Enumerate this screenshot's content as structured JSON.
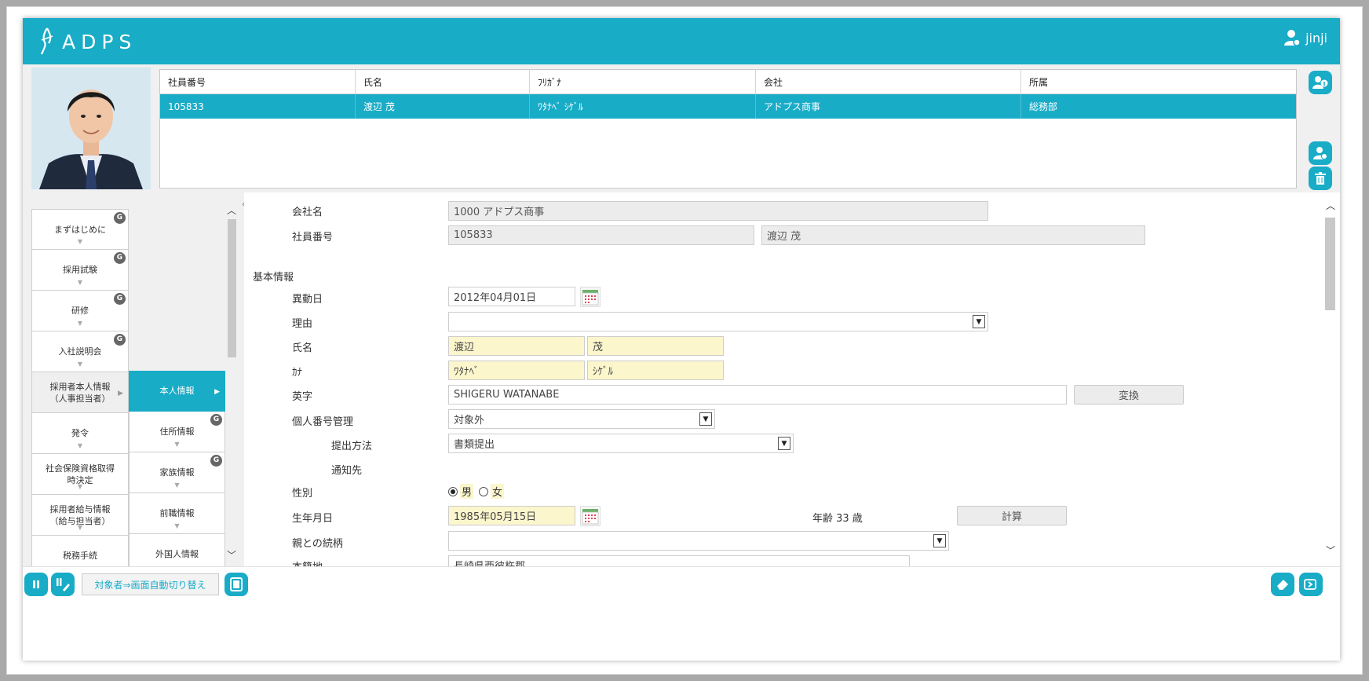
{
  "app": {
    "logo_text": "ADPS",
    "user_name": "jinji"
  },
  "employee_grid": {
    "headers": [
      "社員番号",
      "氏名",
      "ﾌﾘｶﾞﾅ",
      "会社",
      "所属"
    ],
    "row": [
      "105833",
      "渡辺 茂",
      "ﾜﾀﾅﾍﾞ ｼｹﾞﾙ",
      "アドプス商事",
      "総務部"
    ]
  },
  "nav": {
    "col1": [
      {
        "label": "まずはじめに",
        "badge": "G"
      },
      {
        "label": "採用試験",
        "badge": "G"
      },
      {
        "label": "研修",
        "badge": "G"
      },
      {
        "label": "入社説明会",
        "badge": "G"
      },
      {
        "label": "採用者本人情報\n（人事担当者）",
        "badge": ""
      },
      {
        "label": "発令",
        "badge": ""
      },
      {
        "label": "社会保険資格取得\n時決定",
        "badge": ""
      },
      {
        "label": "採用者給与情報\n（給与担当者）",
        "badge": ""
      },
      {
        "label": "税務手続",
        "badge": ""
      }
    ],
    "col2": [
      {
        "label": "本人情報",
        "badge": ""
      },
      {
        "label": "住所情報",
        "badge": "G"
      },
      {
        "label": "家族情報",
        "badge": "G"
      },
      {
        "label": "前職情報",
        "badge": ""
      },
      {
        "label": "外国人情報",
        "badge": ""
      }
    ]
  },
  "form": {
    "company_label": "会社名",
    "company_value": "1000 アドプス商事",
    "emp_no_label": "社員番号",
    "emp_no_value": "105833",
    "emp_name_value": "渡辺 茂",
    "section_basic": "基本情報",
    "transfer_date_label": "異動日",
    "transfer_date_value": "2012年04月01日",
    "reason_label": "理由",
    "reason_value": "",
    "name_label": "氏名",
    "last_name": "渡辺",
    "first_name": "茂",
    "kana_label": "ｶﾅ",
    "last_kana": "ﾜﾀﾅﾍﾞ",
    "first_kana": "ｼｹﾞﾙ",
    "roman_label": "英字",
    "roman_value": "SHIGERU WATANABE",
    "convert_button": "変換",
    "mynumber_label": "個人番号管理",
    "mynumber_value": "対象外",
    "submit_method_label": "提出方法",
    "submit_method_value": "書類提出",
    "notify_label": "通知先",
    "gender_label": "性別",
    "gender_male": "男",
    "gender_female": "女",
    "birth_label": "生年月日",
    "birth_value": "1985年05月15日",
    "age_text": "年齢 33 歳",
    "calc_button": "計算",
    "relation_label": "親との続柄",
    "relation_value": "",
    "domicile_label": "本籍地",
    "domicile_value": "長崎県西彼杵郡"
  },
  "bottom": {
    "auto_switch_label": "対象者⇒画面自動切り替え"
  },
  "colors": {
    "accent": "#18acc7",
    "required": "#fbf6cc",
    "readonly": "#ececec"
  }
}
